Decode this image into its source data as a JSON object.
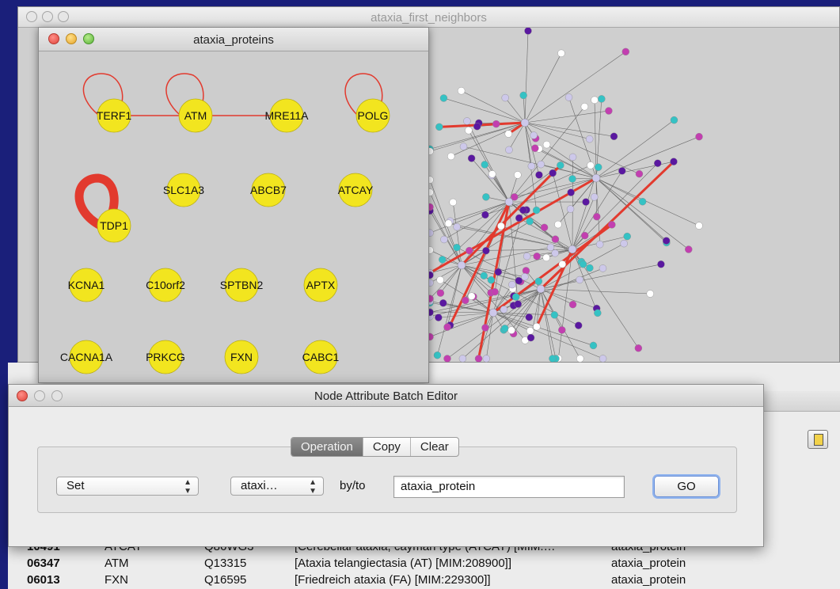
{
  "back_window": {
    "title": "ataxia_first_neighbors"
  },
  "proteins_window": {
    "title": "ataxia_proteins",
    "nodes": [
      "TERF1",
      "ATM",
      "MRE11A",
      "POLG",
      "TDP1",
      "SLC1A3",
      "ABCB7",
      "ATCAY",
      "KCNA1",
      "C10orf2",
      "SPTBN2",
      "APTX",
      "CACNA1A",
      "PRKCG",
      "FXN",
      "CABC1"
    ]
  },
  "dialog": {
    "title": "Node Attribute Batch Editor",
    "tabs": [
      "Operation",
      "Copy",
      "Clear"
    ],
    "active_tab": "Operation",
    "operation_select": "Set",
    "attribute_select": "ataxi…",
    "byto_label": "by/to",
    "value_input": "ataxia_protein",
    "go_label": "GO"
  },
  "table": {
    "rows": [
      [
        "10491",
        "ATCAY",
        "Q86WG3",
        "[Cerebellar ataxia, cayman type (ATCAY) [MIM:…",
        "ataxia_protein"
      ],
      [
        "06347",
        "ATM",
        "Q13315",
        "[Ataxia telangiectasia (AT) [MIM:208900]]",
        "ataxia_protein"
      ],
      [
        "06013",
        "FXN",
        "Q16595",
        "[Friedreich ataxia (FA) [MIM:229300]]",
        "ataxia_protein"
      ]
    ]
  },
  "colors": {
    "node_fill": "#f2e51f",
    "edge_red": "#e23a2e",
    "network_cyan": "#35c2c4",
    "network_magenta": "#c23fb0",
    "network_purple": "#5a18a0",
    "network_lavender": "#cdc8ea"
  }
}
